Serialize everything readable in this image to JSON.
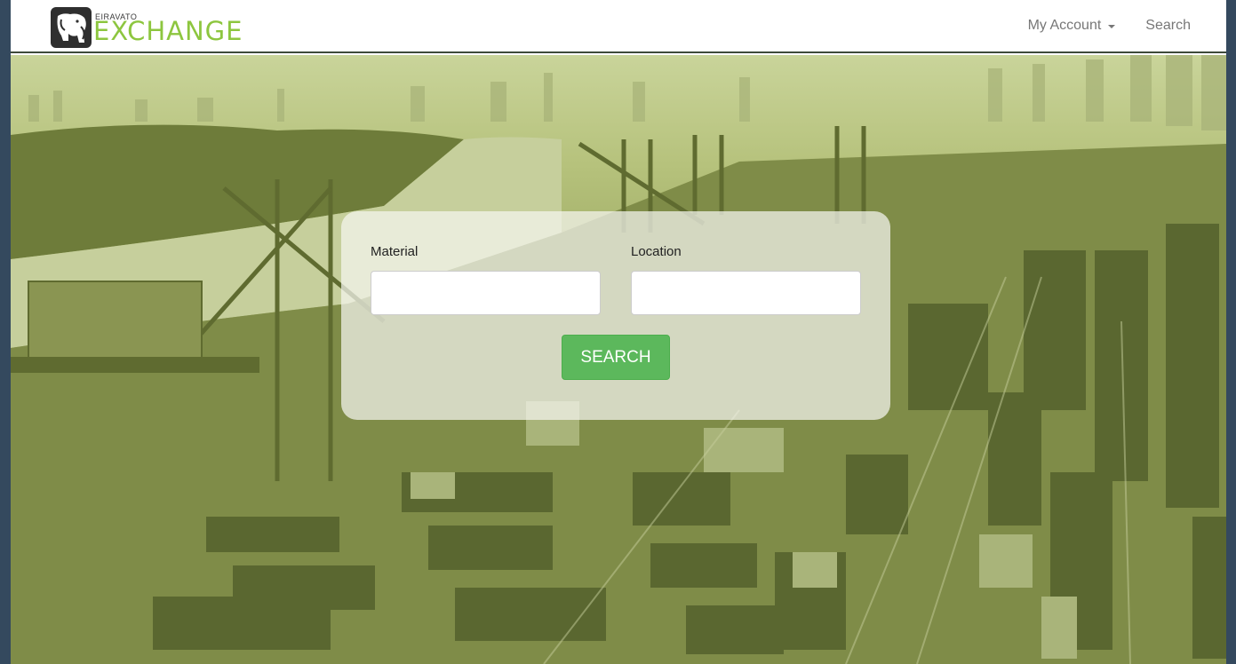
{
  "brand": {
    "small": "EIRAVATO",
    "big": "EXCHANGE",
    "accent": "#8dc63f"
  },
  "nav": {
    "account_label": "My Account",
    "search_label": "Search"
  },
  "search_form": {
    "material_label": "Material",
    "material_value": "",
    "location_label": "Location",
    "location_value": "",
    "button_label": "SEARCH",
    "button_color": "#5cb85c"
  },
  "hero": {
    "tint": "#9aa860"
  }
}
